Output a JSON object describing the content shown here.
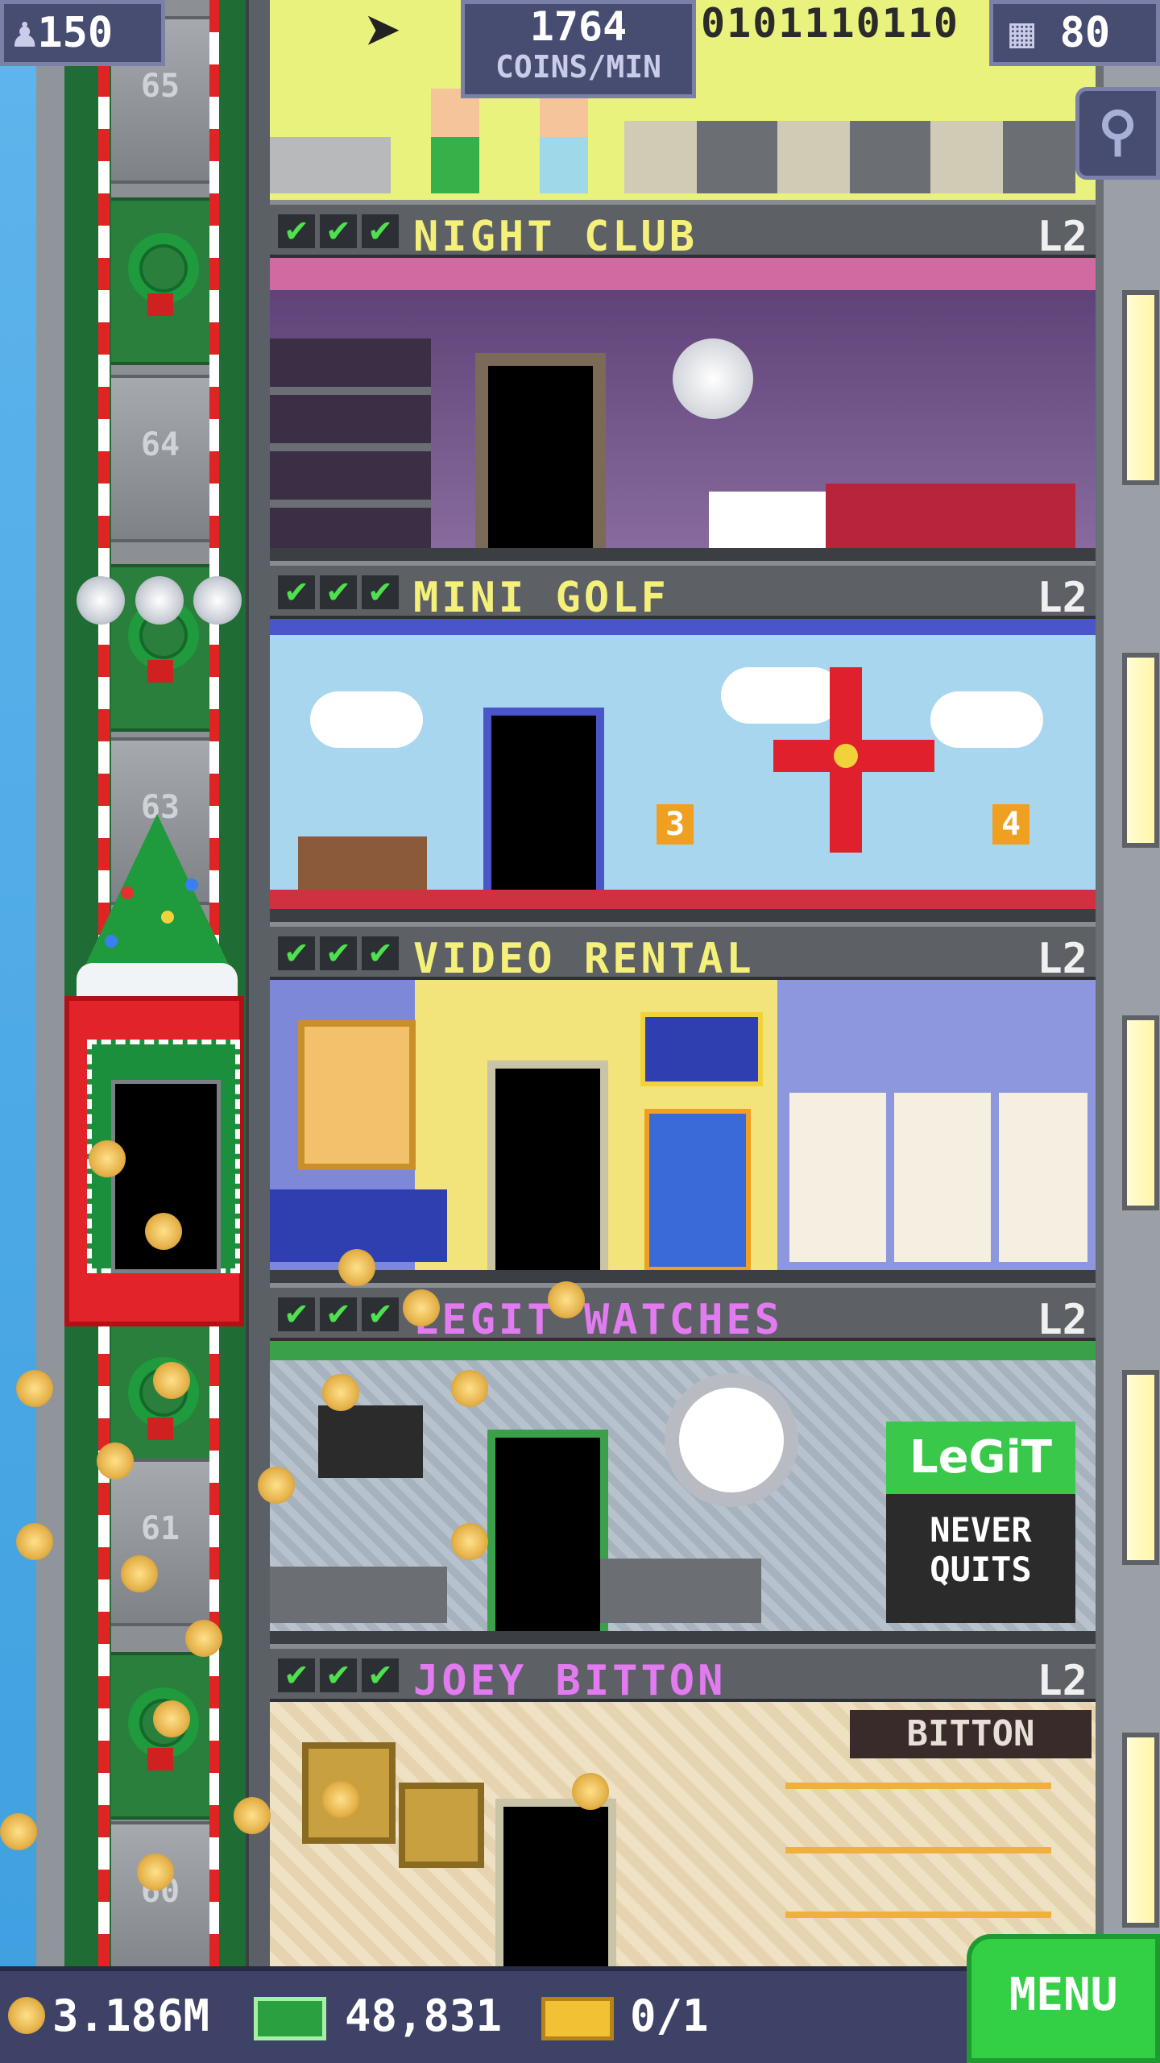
{
  "hud": {
    "population": "150",
    "coins_per_min_value": "1764",
    "coins_per_min_label": "COINS/MIN",
    "binary": "0101110110",
    "floors": "80"
  },
  "shaft_labels": {
    "f65": "65",
    "f64": "64",
    "f63": "63",
    "f61": "61",
    "f60": "60"
  },
  "rooms": [
    {
      "name": "NIGHT CLUB",
      "level": "L2",
      "checks": [
        "✔",
        "✔",
        "✔"
      ],
      "name_color": "#f5f07a"
    },
    {
      "name": "MINI GOLF",
      "level": "L2",
      "checks": [
        "✔",
        "✔",
        "✔"
      ],
      "name_color": "#f5f07a"
    },
    {
      "name": "VIDEO RENTAL",
      "level": "L2",
      "checks": [
        "✔",
        "✔",
        "✔"
      ],
      "name_color": "#f5f07a"
    },
    {
      "name": "LEGIT WATCHES",
      "level": "L2",
      "checks": [
        "✔",
        "✔",
        "✔"
      ],
      "name_color": "#e27bf0"
    },
    {
      "name": "JOEY BITTON",
      "level": "L2",
      "checks": [
        "✔",
        "✔",
        "✔"
      ],
      "name_color": "#e27bf0"
    }
  ],
  "signs": {
    "golf_hole_3": "3",
    "golf_hole_4": "4",
    "legit_logo": "LeGiT",
    "legit_slogan_1": "NEVER",
    "legit_slogan_2": "QUITS",
    "bitton_sign": "BITTON"
  },
  "bottom_bar": {
    "coins": "3.186M",
    "bux": "48,831",
    "tickets": "0/1",
    "menu_label": "MENU"
  },
  "colors": {
    "hud_bg": "#474c71",
    "menu_green": "#33d046",
    "check_green": "#4ee04e",
    "room_name_yellow": "#f5f07a",
    "room_name_pink": "#e27bf0"
  },
  "icons": {
    "population": "person-icon",
    "floors": "building-icon",
    "search": "magnifier-icon",
    "coins": "coin-icon",
    "bux": "bux-bill-icon",
    "tickets": "ticket-icon"
  }
}
